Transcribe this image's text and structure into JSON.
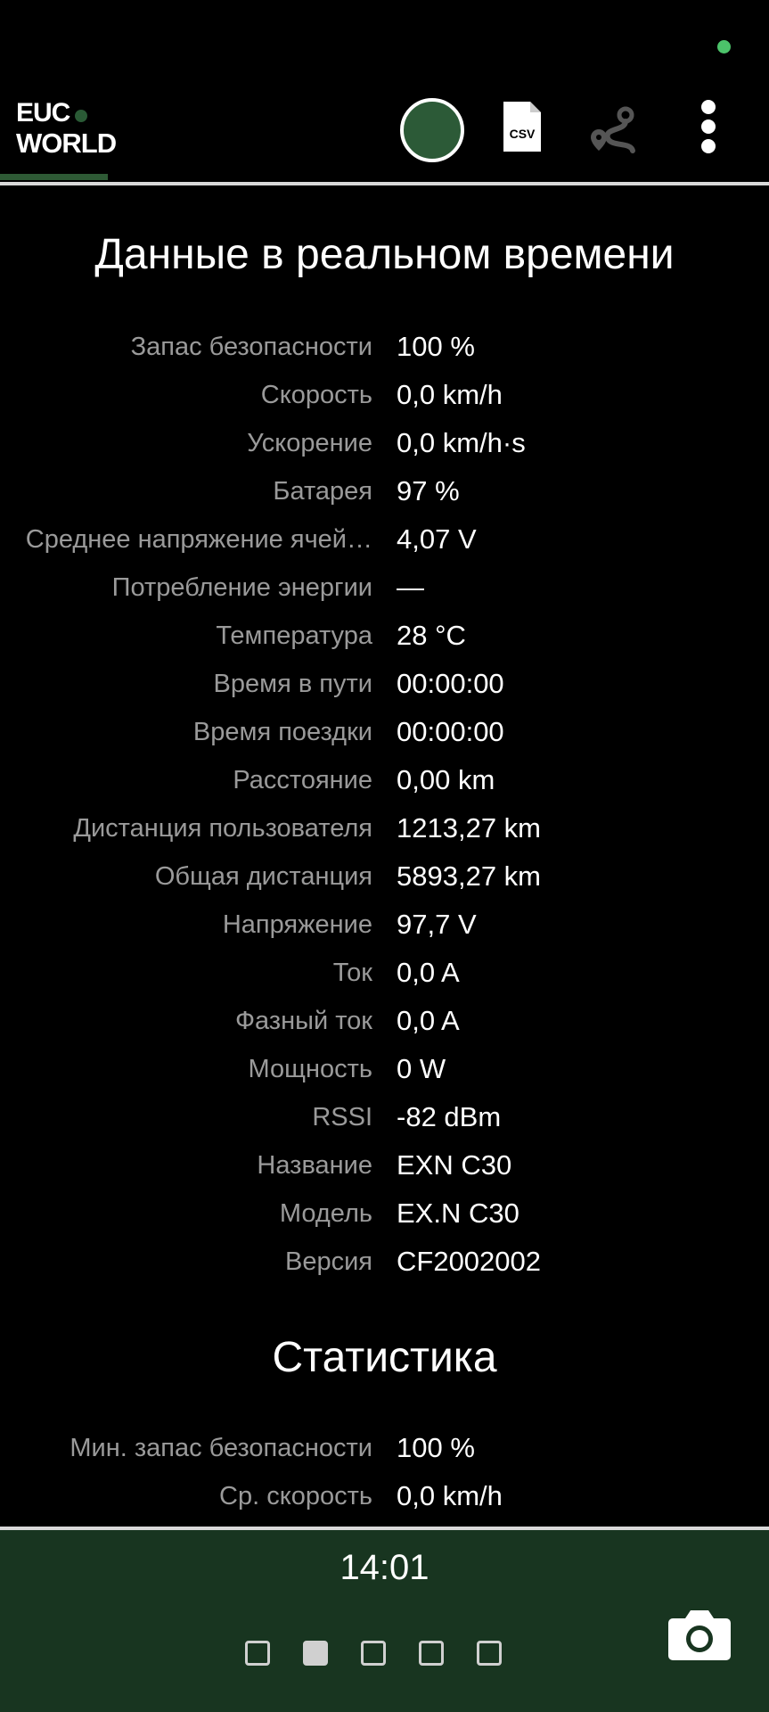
{
  "header": {
    "logo_line1": "EUC",
    "logo_line2": "WORLD",
    "csv_label": "CSV"
  },
  "realtime": {
    "title": "Данные в реальном времени",
    "rows": [
      {
        "label": "Запас безопасности",
        "value": "100 %"
      },
      {
        "label": "Скорость",
        "value": "0,0 km/h"
      },
      {
        "label": "Ускорение",
        "value": "0,0 km/h·s"
      },
      {
        "label": "Батарея",
        "value": "97 %"
      },
      {
        "label": "Среднее напряжение ячей…",
        "value": "4,07 V"
      },
      {
        "label": "Потребление энергии",
        "value": "—"
      },
      {
        "label": "Температура",
        "value": "28 °C"
      },
      {
        "label": "Время в пути",
        "value": "00:00:00"
      },
      {
        "label": "Время поездки",
        "value": "00:00:00"
      },
      {
        "label": "Расстояние",
        "value": "0,00 km"
      },
      {
        "label": "Дистанция пользователя",
        "value": "1213,27 km"
      },
      {
        "label": "Общая дистанция",
        "value": "5893,27 km"
      },
      {
        "label": "Напряжение",
        "value": "97,7 V"
      },
      {
        "label": "Ток",
        "value": "0,0 A"
      },
      {
        "label": "Фазный ток",
        "value": "0,0 A"
      },
      {
        "label": "Мощность",
        "value": "0 W"
      },
      {
        "label": "RSSI",
        "value": "-82 dBm"
      },
      {
        "label": "Название",
        "value": "EXN C30"
      },
      {
        "label": "Модель",
        "value": "EX.N C30"
      },
      {
        "label": "Версия",
        "value": "CF2002002"
      }
    ]
  },
  "statistics": {
    "title": "Статистика",
    "rows": [
      {
        "label": "Мин. запас безопасности",
        "value": "100 %"
      },
      {
        "label": "Ср. скорость",
        "value": "0,0 km/h"
      }
    ]
  },
  "bottom": {
    "clock": "14:01",
    "pages": 5,
    "active_page": 2
  },
  "colors": {
    "accent": "#2c5a37",
    "bottom_bar": "#183520",
    "status_dot": "#4cc36a",
    "label": "#9a9a9a"
  },
  "icons": [
    "record-button-icon",
    "csv-file-icon",
    "route-icon",
    "more-vert-icon",
    "camera-icon"
  ]
}
